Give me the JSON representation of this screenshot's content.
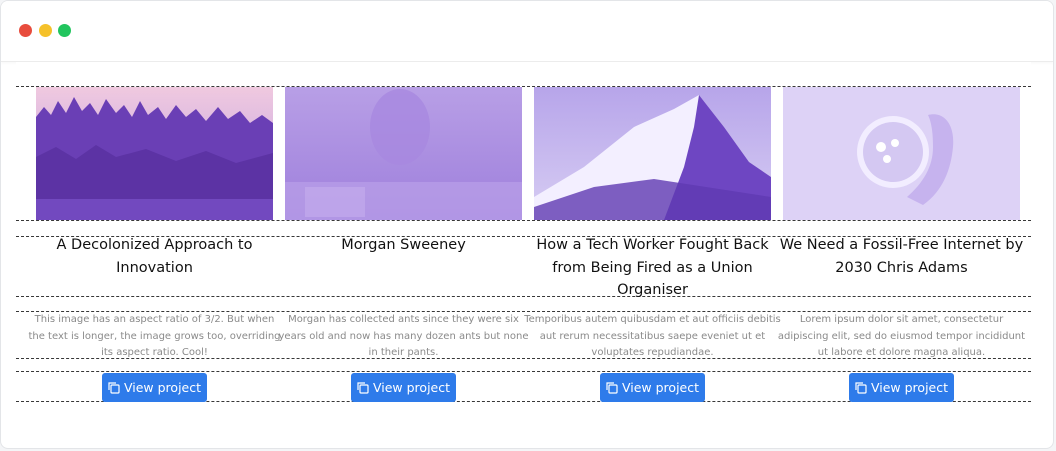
{
  "window": {
    "controls": [
      "close",
      "minimize",
      "maximize"
    ],
    "colors": {
      "close": "#e84c3d",
      "minimize": "#f5c12a",
      "maximize": "#22c55e"
    }
  },
  "cards": [
    {
      "image": "forest-image",
      "title": "A Decolonized Approach to Innovation",
      "description": "This image has an aspect ratio of 3/2. But when the text is longer, the image grows too, overriding its aspect ratio. Cool!",
      "button_label": "View project"
    },
    {
      "image": "portrait-image",
      "title": "Morgan Sweeney",
      "description": "Morgan has collected ants since they were six years old and now has many dozen ants but none in their pants.",
      "button_label": "View project"
    },
    {
      "image": "mountain-image",
      "title": "How a Tech Worker Fought Back from Being Fired as a Union Organiser",
      "description": "Temporibus autem quibusdam et aut officiis debitis aut rerum necessitatibus saepe eveniet ut et voluptates repudiandae.",
      "button_label": "View project"
    },
    {
      "image": "cup-image",
      "title": "We Need a Fossil-Free Internet by 2030 Chris Adams",
      "description": "Lorem ipsum dolor sit amet, consectetur adipiscing elit, sed do eiusmod tempor incididunt ut labore et dolore magna aliqua.",
      "button_label": "View project"
    }
  ],
  "colors": {
    "accent": "#2e7bea",
    "image_tint": "#7b56d6"
  },
  "icons": {
    "button_icon": "copy-icon"
  }
}
